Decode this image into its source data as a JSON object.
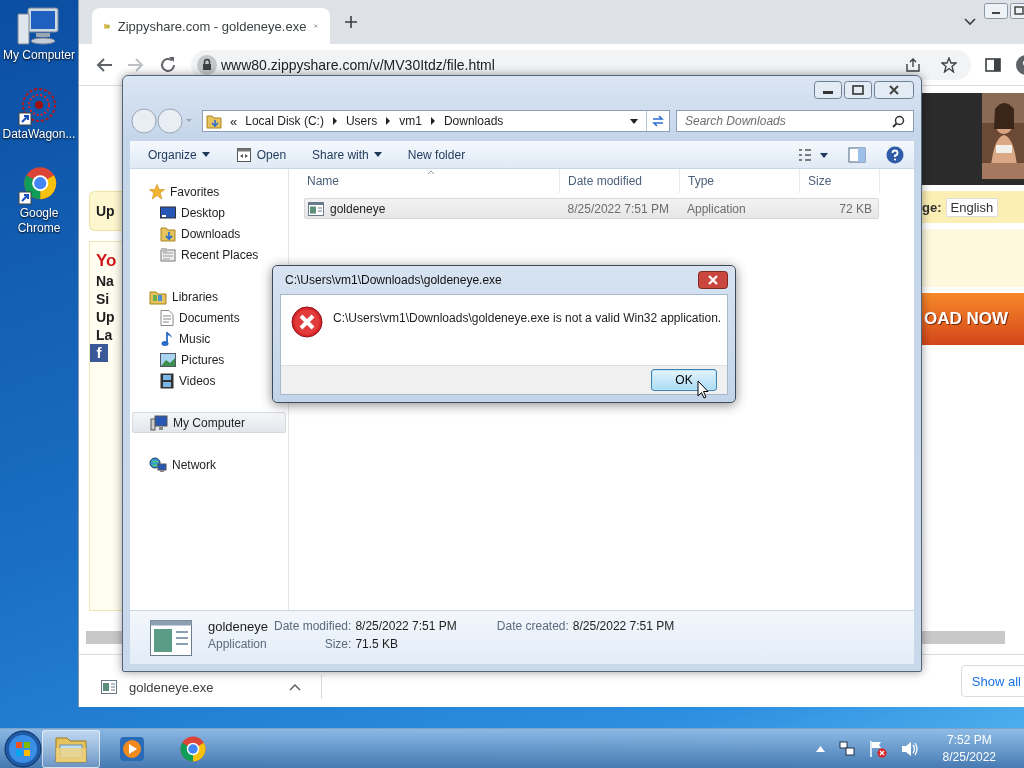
{
  "desktop_icons": [
    {
      "label": "My Computer",
      "kind": "computer",
      "shortcut": false
    },
    {
      "label": "DataWagon...",
      "kind": "burst",
      "shortcut": true
    },
    {
      "label": "Google Chrome",
      "kind": "chrome",
      "shortcut": true
    }
  ],
  "browser": {
    "tabs": [
      {
        "title": "Zippyshare.com - goldeneye.exe",
        "selected": true
      }
    ],
    "nav": {
      "back_disabled": false,
      "forward_disabled": true
    },
    "url": "www80.zippyshare.com/v/MV30Itdz/file.html",
    "page": {
      "banner_text": "Up",
      "info_lines": [
        {
          "text": "Yo",
          "kind": "heading"
        },
        {
          "text": "Na",
          "kind": "label"
        },
        {
          "text": "Si",
          "kind": "label"
        },
        {
          "text": "Up",
          "kind": "label"
        },
        {
          "text": "La",
          "kind": "label"
        }
      ],
      "social_button": "f",
      "language_label": "ge:",
      "language_value": "English",
      "download_banner": "OAD NOW"
    },
    "download_bar": {
      "file": "goldeneye.exe",
      "button": "Show all"
    }
  },
  "explorer": {
    "breadcrumb": {
      "overflow": "«",
      "parts": [
        "Local Disk (C:)",
        "Users",
        "vm1",
        "Downloads"
      ]
    },
    "search": {
      "placeholder": "Search Downloads"
    },
    "commands": [
      {
        "label": "Organize",
        "kind": "plain",
        "dropdown": true
      },
      {
        "label": "Open",
        "kind": "open",
        "dropdown": false
      },
      {
        "label": "Share with",
        "kind": "plain",
        "dropdown": true
      },
      {
        "label": "New folder",
        "kind": "plain",
        "dropdown": false
      }
    ],
    "sidebar": [
      {
        "label": "Favorites",
        "kind": "star",
        "selected": false,
        "children": [
          {
            "label": "Desktop",
            "kind": "desktop",
            "selected": false
          },
          {
            "label": "Downloads",
            "kind": "downloads",
            "selected": false
          },
          {
            "label": "Recent Places",
            "kind": "recent",
            "selected": false
          }
        ]
      },
      {
        "label": "Libraries",
        "kind": "libraries",
        "selected": false,
        "children": [
          {
            "label": "Documents",
            "kind": "document",
            "selected": false
          },
          {
            "label": "Music",
            "kind": "music",
            "selected": false
          },
          {
            "label": "Pictures",
            "kind": "pictures",
            "selected": false
          },
          {
            "label": "Videos",
            "kind": "videos",
            "selected": false
          }
        ]
      },
      {
        "label": "My Computer",
        "kind": "computer",
        "selected": true
      },
      {
        "label": "Network",
        "kind": "network",
        "selected": false
      }
    ],
    "columns": [
      "Name",
      "Date modified",
      "Type",
      "Size"
    ],
    "files": [
      {
        "name": "goldeneye",
        "date": "8/25/2022 7:51 PM",
        "type": "Application",
        "size": "72 KB",
        "selected": true
      }
    ],
    "details": {
      "name": "goldeneye",
      "type": "Application",
      "fields": [
        {
          "label": "Date modified:",
          "value": "8/25/2022 7:51 PM"
        },
        {
          "label": "Size:",
          "value": "71.5 KB"
        },
        {
          "label": "Date created:",
          "value": "8/25/2022 7:51 PM"
        }
      ]
    }
  },
  "dialog": {
    "title": "C:\\Users\\vm1\\Downloads\\goldeneye.exe",
    "kind": "error",
    "message": "C:\\Users\\vm1\\Downloads\\goldeneye.exe is not a valid Win32 application.",
    "buttons": [
      {
        "label": "OK",
        "focused": true
      }
    ]
  },
  "taskbar": {
    "apps": [
      {
        "kind": "explorer",
        "selected": true
      },
      {
        "kind": "media",
        "selected": false
      },
      {
        "kind": "chrome",
        "selected": false
      }
    ],
    "time": "7:52 PM",
    "date": "8/25/2022"
  }
}
